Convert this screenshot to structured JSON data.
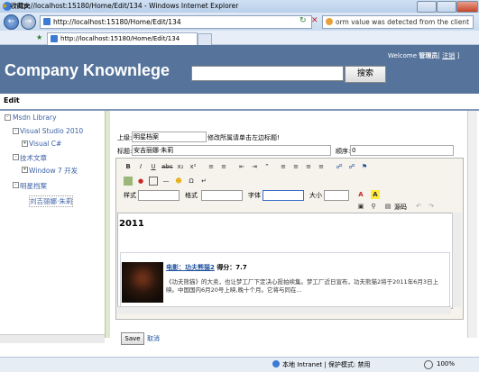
{
  "browser": {
    "window_title": "http://localhost:15180/Home/Edit/134 - Windows Internet Explorer",
    "address": "http://localhost:15180/Home/Edit/134",
    "search_text": "orm value was detected from the client",
    "favorites_label": "收藏夹",
    "tab_title": "http://localhost:15180/Home/Edit/134"
  },
  "header": {
    "brand": "Company Knownlege",
    "welcome_prefix": "Welcome",
    "user": "管理员",
    "logout": "注销",
    "search_button": "搜索"
  },
  "page": {
    "mode": "Edit"
  },
  "tree": {
    "root": "Msdn Library",
    "items": [
      "Visual Studio 2010",
      "Visual C#",
      "技术文章",
      "Window 7 开发",
      "明星档案",
      "刘吉丽娜·朱莉"
    ]
  },
  "form": {
    "parent_label": "上级:",
    "parent_value": "明星档案",
    "parent_hint": "修改所属请单击左边标题!",
    "title_label": "标题:",
    "title_value": "安吉丽娜·朱莉",
    "order_label": "顺序:",
    "order_value": "0"
  },
  "toolbar": {
    "style_label": "样式",
    "format_label": "格式",
    "font_label": "字体",
    "size_label": "大小",
    "source_label": "源码"
  },
  "content": {
    "year": "2011",
    "article_link": "电影：功夫熊猫2",
    "article_score": "得分：7.7",
    "article_body": "《功夫熊猫》的大卖，也让梦工厂下定决心投拍续集。梦工厂近日宣布，功夫熊猫2将于2011年6月3日上映。中国国内6月20号上映,晚十个月。它将与同在..."
  },
  "actions": {
    "save": "Save",
    "cancel": "取消"
  },
  "status": {
    "zone": "本地 Intranet | 保护模式: 禁用",
    "zoom": "100%"
  }
}
